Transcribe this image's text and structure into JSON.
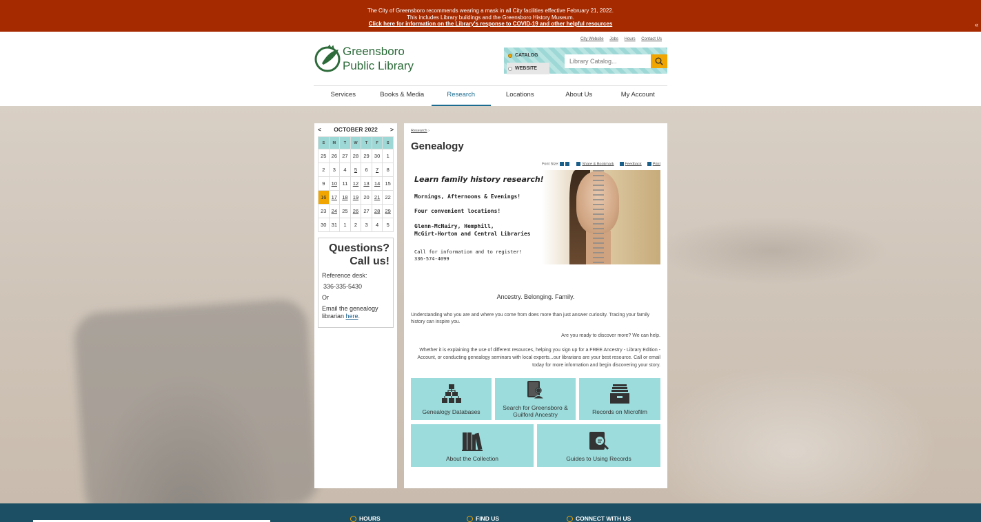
{
  "alert": {
    "line1": "The City of Greensboro recommends wearing a mask in all City facilities effective February 21, 2022.",
    "line2": "This includes Library buildings and the Greensboro History Museum.",
    "link": "Click here for information on the Library's response to COVID-19 and other helpful resources",
    "collapse_glyph": "«"
  },
  "header": {
    "logo_line1": "Greensboro",
    "logo_line2": "Public Library",
    "util_links": [
      "City Website",
      "Jobs",
      "Hours",
      "Contact Us"
    ],
    "search": {
      "option_catalog": "CATALOG",
      "option_website": "WEBSITE",
      "placeholder": "Library Catalog...",
      "selected": "CATALOG"
    },
    "nav": [
      {
        "label": "Services"
      },
      {
        "label": "Books & Media"
      },
      {
        "label": "Research",
        "active": true
      },
      {
        "label": "Locations"
      },
      {
        "label": "About Us"
      },
      {
        "label": "My Account"
      }
    ]
  },
  "calendar": {
    "prev": "<",
    "next": ">",
    "month": "OCTOBER 2022",
    "weekdays": [
      "S",
      "M",
      "T",
      "W",
      "T",
      "F",
      "S"
    ],
    "weeks": [
      [
        "25",
        "26",
        "27",
        "28",
        "29",
        "30",
        "1"
      ],
      [
        "2",
        "3",
        "4",
        "5",
        "6",
        "7",
        "8"
      ],
      [
        "9",
        "10",
        "11",
        "12",
        "13",
        "14",
        "15"
      ],
      [
        "16",
        "17",
        "18",
        "19",
        "20",
        "21",
        "22"
      ],
      [
        "23",
        "24",
        "25",
        "26",
        "27",
        "28",
        "29"
      ],
      [
        "30",
        "31",
        "1",
        "2",
        "3",
        "4",
        "5"
      ]
    ],
    "today": "16",
    "event_days": [
      "5",
      "7",
      "10",
      "12",
      "13",
      "14",
      "17",
      "18",
      "19",
      "21",
      "24",
      "26",
      "28",
      "29"
    ]
  },
  "questions": {
    "title_line1": "Questions?",
    "title_line2": "Call us!",
    "ref_label": "Reference desk:",
    "phone": "336-335-5430",
    "or": "Or",
    "email_text": "Email the genealogy librarian",
    "email_link": "here"
  },
  "main": {
    "breadcrumb": "Research",
    "breadcrumb_sep": "›",
    "title": "Genealogy",
    "tools": {
      "font_size": "Font Size:",
      "share": "Share & Bookmark",
      "feedback": "Feedback",
      "print": "Print"
    },
    "banner": {
      "headline": "Learn family history research!",
      "times": "Mornings, Afternoons & Evenings!",
      "locations_count": "Four convenient locations!",
      "locations_1": "Glenn-McNairy, Hemphill,",
      "locations_2": "McGirt-Horton and Central Libraries",
      "call": "Call for information and to register!",
      "phone": "336-574-4099"
    },
    "tagline": "Ancestry. Belonging. Family.",
    "para1": "Understanding who you are and where you come from does more than just answer curiosity.  Tracing your family history can inspire you.",
    "para2": "Are you ready to discover more? We can help.",
    "para3": "Whether it is explaining the use of different resources, helping you sign up for a FREE Ancestry - Library Edition - Account, or conducting genealogy seminars with local experts...our librarians are your best resource. Call or email today for more information and begin discovering your story.",
    "tiles": [
      {
        "label": "Genealogy Databases",
        "icon": "hierarchy-icon"
      },
      {
        "label": "Search for Greensboro & Guilford Ancestry",
        "icon": "person-book-icon"
      },
      {
        "label": "Records on Microfilm",
        "icon": "archive-box-icon"
      },
      {
        "label": "About the Collection",
        "icon": "books-icon"
      },
      {
        "label": "Guides to Using Records",
        "icon": "book-magnifier-icon"
      }
    ]
  },
  "footer": {
    "hours": "HOURS",
    "find_us": "FIND US",
    "connect": "CONNECT WITH US"
  },
  "colors": {
    "alert_bg": "#a52a00",
    "brand_green": "#2d6b3a",
    "accent_orange": "#f0a500",
    "tile_teal": "#9ddcdc",
    "nav_active": "#1a6b8f",
    "footer_bg": "#1c4f63"
  }
}
